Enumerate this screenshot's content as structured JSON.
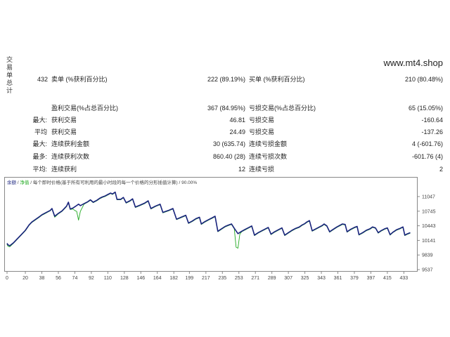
{
  "report": {
    "side_title": "交易单总计",
    "watermark": "www.mt4.shop",
    "total_trades": "432",
    "short_label": "卖单 (%获利百分比)",
    "short_value": "222 (89.19%)",
    "long_label": "买单 (%获利百分比)",
    "long_value": "210 (80.48%)",
    "profit_trades_label": "盈利交易(%占总百分比)",
    "profit_trades_value": "367 (84.95%)",
    "loss_trades_label": "亏损交易(%占总百分比)",
    "loss_trades_value": "65 (15.05%)",
    "largest_prefix": "最大:",
    "largest_profit_label": "获利交易",
    "largest_profit_value": "46.81",
    "largest_loss_label": "亏损交易",
    "largest_loss_value": "-160.64",
    "average_prefix": "平均",
    "average_profit_label": "获利交易",
    "average_profit_value": "24.49",
    "average_loss_label": "亏损交易",
    "average_loss_value": "-137.26",
    "max_consec_prefix": "最大:",
    "max_consec_wins_label": "连续获利金额",
    "max_consec_wins_value": "30 (635.74)",
    "max_consec_losses_label": "连续亏损金额",
    "max_consec_losses_value": "4 (-601.76)",
    "maximal_prefix": "最多:",
    "maximal_profit_label": "连续获利次数",
    "maximal_profit_value": "860.40 (28)",
    "maximal_loss_label": "连续亏损次数",
    "maximal_loss_value": "-601.76 (4)",
    "avg_consec_prefix": "平均:",
    "avg_consec_wins_label": "连续获利",
    "avg_consec_wins_value": "12",
    "avg_consec_losses_label": "连续亏损",
    "avg_consec_losses_value": "2"
  },
  "chart_data": {
    "type": "line",
    "legend_text": "余额 / 净值 / 每个即时价格(基于所有可利用的最小时段的每一个价格的分形插值计算) / 90.00%",
    "legend_parts": [
      "余额",
      " / ",
      "净值",
      " / 每个即时价格(基于所有可利用的最小时段的每一个价格的分形插值计算) / 90.00%"
    ],
    "colors": {
      "balance": "#1a237e",
      "equity": "#22aa22",
      "legend_balance": "#1a237e",
      "legend_equity": "#22aa22",
      "text": "#444444",
      "frame": "#888888"
    },
    "ylim": [
      9537,
      11250
    ],
    "y_ticks": [
      9537,
      9839,
      10141,
      10443,
      10745,
      11047
    ],
    "xlim": [
      0,
      445
    ],
    "x_ticks": [
      0,
      20,
      38,
      56,
      74,
      92,
      110,
      128,
      146,
      164,
      182,
      199,
      217,
      235,
      253,
      271,
      289,
      307,
      325,
      343,
      361,
      379,
      397,
      415,
      433
    ],
    "series": [
      {
        "key": "balance",
        "points": [
          [
            0,
            10080
          ],
          [
            1,
            10050
          ],
          [
            3,
            10030
          ],
          [
            7,
            10090
          ],
          [
            11,
            10170
          ],
          [
            15,
            10250
          ],
          [
            20,
            10350
          ],
          [
            24,
            10460
          ],
          [
            27,
            10520
          ],
          [
            30,
            10560
          ],
          [
            33,
            10600
          ],
          [
            36,
            10640
          ],
          [
            38,
            10670
          ],
          [
            40,
            10690
          ],
          [
            44,
            10730
          ],
          [
            47,
            10760
          ],
          [
            49,
            10800
          ],
          [
            52,
            10640
          ],
          [
            56,
            10700
          ],
          [
            60,
            10750
          ],
          [
            62,
            10790
          ],
          [
            65,
            10850
          ],
          [
            67,
            10930
          ],
          [
            69,
            10790
          ],
          [
            72,
            10810
          ],
          [
            75,
            10850
          ],
          [
            78,
            10890
          ],
          [
            80,
            10860
          ],
          [
            84,
            10900
          ],
          [
            88,
            10940
          ],
          [
            91,
            10980
          ],
          [
            94,
            10930
          ],
          [
            98,
            10970
          ],
          [
            101,
            11010
          ],
          [
            104,
            11040
          ],
          [
            107,
            11060
          ],
          [
            110,
            11090
          ],
          [
            113,
            11120
          ],
          [
            115,
            11100
          ],
          [
            118,
            11140
          ],
          [
            120,
            10990
          ],
          [
            124,
            10990
          ],
          [
            127,
            11030
          ],
          [
            130,
            10920
          ],
          [
            134,
            10960
          ],
          [
            137,
            11000
          ],
          [
            140,
            10830
          ],
          [
            145,
            10870
          ],
          [
            150,
            10910
          ],
          [
            154,
            10960
          ],
          [
            157,
            10800
          ],
          [
            162,
            10850
          ],
          [
            167,
            10890
          ],
          [
            170,
            10720
          ],
          [
            176,
            10760
          ],
          [
            181,
            10800
          ],
          [
            185,
            10580
          ],
          [
            190,
            10620
          ],
          [
            195,
            10660
          ],
          [
            198,
            10500
          ],
          [
            202,
            10540
          ],
          [
            206,
            10590
          ],
          [
            210,
            10620
          ],
          [
            212,
            10480
          ],
          [
            216,
            10530
          ],
          [
            220,
            10570
          ],
          [
            224,
            10610
          ],
          [
            227,
            10640
          ],
          [
            230,
            10330
          ],
          [
            234,
            10380
          ],
          [
            238,
            10430
          ],
          [
            242,
            10460
          ],
          [
            245,
            10480
          ],
          [
            248,
            10390
          ],
          [
            252,
            10280
          ],
          [
            256,
            10330
          ],
          [
            260,
            10370
          ],
          [
            264,
            10410
          ],
          [
            267,
            10440
          ],
          [
            270,
            10250
          ],
          [
            274,
            10300
          ],
          [
            278,
            10340
          ],
          [
            282,
            10380
          ],
          [
            285,
            10410
          ],
          [
            288,
            10270
          ],
          [
            292,
            10320
          ],
          [
            296,
            10360
          ],
          [
            300,
            10400
          ],
          [
            303,
            10250
          ],
          [
            307,
            10300
          ],
          [
            311,
            10350
          ],
          [
            315,
            10390
          ],
          [
            319,
            10420
          ],
          [
            322,
            10460
          ],
          [
            325,
            10490
          ],
          [
            327,
            10520
          ],
          [
            330,
            10550
          ],
          [
            333,
            10340
          ],
          [
            337,
            10380
          ],
          [
            341,
            10420
          ],
          [
            344,
            10450
          ],
          [
            346,
            10480
          ],
          [
            349,
            10440
          ],
          [
            352,
            10320
          ],
          [
            356,
            10370
          ],
          [
            360,
            10420
          ],
          [
            363,
            10450
          ],
          [
            366,
            10480
          ],
          [
            369,
            10470
          ],
          [
            371,
            10320
          ],
          [
            375,
            10370
          ],
          [
            379,
            10410
          ],
          [
            382,
            10430
          ],
          [
            384,
            10260
          ],
          [
            388,
            10300
          ],
          [
            392,
            10350
          ],
          [
            396,
            10380
          ],
          [
            399,
            10420
          ],
          [
            402,
            10400
          ],
          [
            405,
            10300
          ],
          [
            408,
            10340
          ],
          [
            412,
            10380
          ],
          [
            415,
            10400
          ],
          [
            418,
            10260
          ],
          [
            421,
            10310
          ],
          [
            425,
            10360
          ],
          [
            429,
            10390
          ],
          [
            432,
            10420
          ],
          [
            434,
            10250
          ],
          [
            436,
            10270
          ],
          [
            440,
            10300
          ]
        ]
      },
      {
        "key": "equity",
        "points": [
          [
            0,
            10060
          ],
          [
            1,
            10020
          ],
          [
            3,
            10010
          ],
          [
            7,
            10080
          ],
          [
            11,
            10160
          ],
          [
            15,
            10240
          ],
          [
            20,
            10340
          ],
          [
            24,
            10450
          ],
          [
            27,
            10510
          ],
          [
            30,
            10550
          ],
          [
            33,
            10590
          ],
          [
            36,
            10630
          ],
          [
            38,
            10660
          ],
          [
            40,
            10680
          ],
          [
            44,
            10720
          ],
          [
            47,
            10750
          ],
          [
            49,
            10790
          ],
          [
            52,
            10620
          ],
          [
            56,
            10690
          ],
          [
            60,
            10740
          ],
          [
            62,
            10780
          ],
          [
            65,
            10840
          ],
          [
            67,
            10920
          ],
          [
            69,
            10780
          ],
          [
            72,
            10790
          ],
          [
            74,
            10760
          ],
          [
            76,
            10740
          ],
          [
            78,
            10560
          ],
          [
            80,
            10740
          ],
          [
            84,
            10890
          ],
          [
            88,
            10930
          ],
          [
            91,
            10970
          ],
          [
            94,
            10920
          ],
          [
            98,
            10960
          ],
          [
            101,
            11000
          ],
          [
            104,
            11030
          ],
          [
            107,
            11050
          ],
          [
            110,
            11080
          ],
          [
            113,
            11110
          ],
          [
            115,
            11090
          ],
          [
            118,
            11130
          ],
          [
            120,
            10980
          ],
          [
            124,
            10980
          ],
          [
            127,
            11020
          ],
          [
            130,
            10910
          ],
          [
            134,
            10950
          ],
          [
            137,
            10990
          ],
          [
            140,
            10820
          ],
          [
            145,
            10860
          ],
          [
            150,
            10900
          ],
          [
            154,
            10950
          ],
          [
            157,
            10790
          ],
          [
            162,
            10840
          ],
          [
            167,
            10880
          ],
          [
            170,
            10710
          ],
          [
            176,
            10750
          ],
          [
            181,
            10790
          ],
          [
            185,
            10570
          ],
          [
            190,
            10610
          ],
          [
            195,
            10650
          ],
          [
            198,
            10490
          ],
          [
            202,
            10530
          ],
          [
            206,
            10580
          ],
          [
            210,
            10610
          ],
          [
            212,
            10470
          ],
          [
            216,
            10520
          ],
          [
            220,
            10560
          ],
          [
            224,
            10600
          ],
          [
            227,
            10630
          ],
          [
            230,
            10320
          ],
          [
            234,
            10370
          ],
          [
            238,
            10420
          ],
          [
            242,
            10450
          ],
          [
            245,
            10470
          ],
          [
            248,
            10380
          ],
          [
            250,
            10000
          ],
          [
            252,
            9980
          ],
          [
            254,
            10270
          ],
          [
            256,
            10320
          ],
          [
            260,
            10360
          ],
          [
            264,
            10400
          ],
          [
            267,
            10430
          ],
          [
            270,
            10240
          ],
          [
            274,
            10290
          ],
          [
            278,
            10330
          ],
          [
            282,
            10370
          ],
          [
            285,
            10400
          ],
          [
            288,
            10260
          ],
          [
            292,
            10310
          ],
          [
            296,
            10350
          ],
          [
            300,
            10390
          ],
          [
            303,
            10240
          ],
          [
            307,
            10290
          ],
          [
            311,
            10340
          ],
          [
            315,
            10380
          ],
          [
            319,
            10410
          ],
          [
            322,
            10450
          ],
          [
            325,
            10480
          ],
          [
            327,
            10510
          ],
          [
            330,
            10540
          ],
          [
            333,
            10330
          ],
          [
            337,
            10370
          ],
          [
            341,
            10410
          ],
          [
            344,
            10440
          ],
          [
            346,
            10470
          ],
          [
            349,
            10430
          ],
          [
            352,
            10310
          ],
          [
            356,
            10360
          ],
          [
            360,
            10410
          ],
          [
            363,
            10440
          ],
          [
            366,
            10470
          ],
          [
            369,
            10460
          ],
          [
            371,
            10310
          ],
          [
            375,
            10360
          ],
          [
            379,
            10400
          ],
          [
            382,
            10420
          ],
          [
            384,
            10250
          ],
          [
            388,
            10290
          ],
          [
            392,
            10340
          ],
          [
            396,
            10370
          ],
          [
            399,
            10410
          ],
          [
            402,
            10390
          ],
          [
            405,
            10290
          ],
          [
            408,
            10330
          ],
          [
            412,
            10370
          ],
          [
            415,
            10390
          ],
          [
            418,
            10250
          ],
          [
            421,
            10300
          ],
          [
            425,
            10350
          ],
          [
            429,
            10380
          ],
          [
            432,
            10410
          ],
          [
            434,
            10240
          ],
          [
            436,
            10260
          ],
          [
            440,
            10290
          ]
        ]
      }
    ]
  }
}
